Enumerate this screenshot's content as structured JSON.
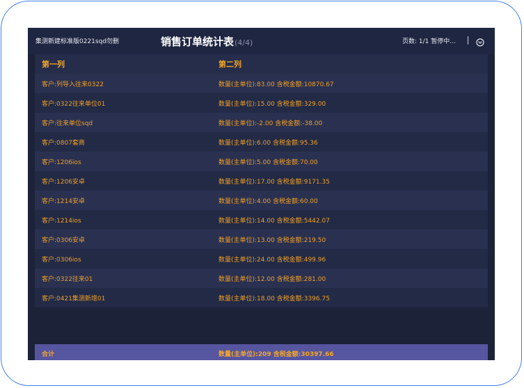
{
  "header": {
    "project_name": "集测新建标准版0221sqd勿删",
    "title": "销售订单统计表",
    "pager": "(4/4)",
    "status": "页数:  1/1  暂停中...",
    "icon": "chevron-down-circle-icon"
  },
  "table": {
    "columns": [
      "第一列",
      "第二列"
    ],
    "rows": [
      {
        "customer": "客户:列导入往来0322",
        "detail": "数量(主单位):83.00 含税金额:10870.67"
      },
      {
        "customer": "客户:0322往来单位01",
        "detail": "数量(主单位):15.00 含税金额:329.00"
      },
      {
        "customer": "客户:往来单位sqd",
        "detail": "数量(主单位):-2.00 含税金额:-38.00"
      },
      {
        "customer": "客户:0807套商",
        "detail": "数量(主单位):6.00 含税金额:95.36"
      },
      {
        "customer": "客户:1206ios",
        "detail": "数量(主单位):5.00 含税金额:70.00"
      },
      {
        "customer": "客户:1206安卓",
        "detail": "数量(主单位):17.00 含税金额:9171.35"
      },
      {
        "customer": "客户:1214安卓",
        "detail": "数量(主单位):4.00 含税金额:60.00"
      },
      {
        "customer": "客户:1214ios",
        "detail": "数量(主单位):14.00 含税金额:5442.07"
      },
      {
        "customer": "客户:0306安卓",
        "detail": "数量(主单位):13.00 含税金额:219.50"
      },
      {
        "customer": "客户:0306ios",
        "detail": "数量(主单位):24.00 含税金额:499.96"
      },
      {
        "customer": "客户:0322往来01",
        "detail": "数量(主单位):12.00 含税金额:281.00"
      },
      {
        "customer": "客户:0421集测新增01",
        "detail": "数量(主单位):18.00 含税金额:3396.75"
      }
    ],
    "total": {
      "label": "合计",
      "detail": "数量(主单位):209 含税金额:30397.66"
    }
  },
  "colors": {
    "accent": "#f0a02a",
    "background": "#1c2238",
    "total_bar": "#5655a0",
    "frame_border": "#3d7fe8"
  }
}
